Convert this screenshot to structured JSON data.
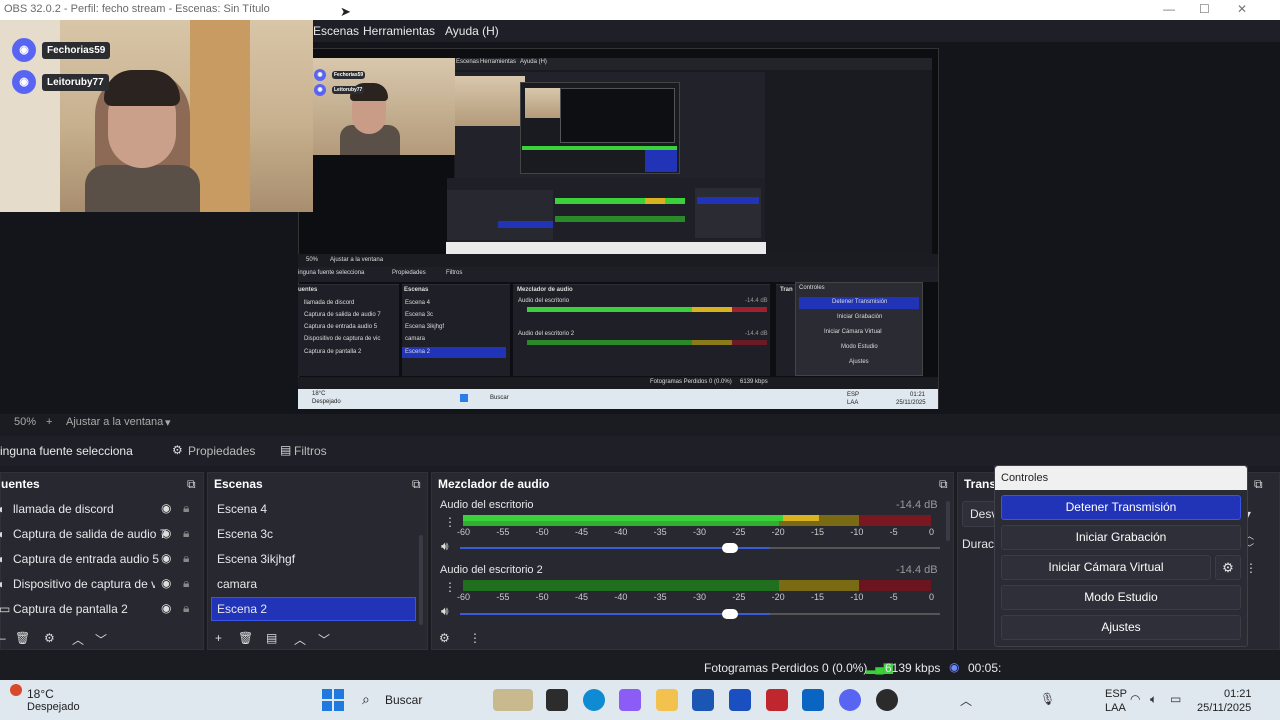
{
  "window": {
    "title": "OBS 32.0.2 - Perfil: fecho stream - Escenas: Sin Título",
    "minimize": "—",
    "maximize": "☐",
    "close": "✕"
  },
  "menu": {
    "items": [
      "Escenas",
      "Herramientas",
      "Ayuda (H)"
    ]
  },
  "webcam": {
    "discord_users": [
      "Fechorias59",
      "Leitoruby77"
    ]
  },
  "zoom": {
    "level": "50%",
    "add": "+",
    "fit_label": "Ajustar a la ventana",
    "dropdown": "▾"
  },
  "source_toolbar": {
    "no_source": "inguna fuente selecciona",
    "properties": "Propiedades",
    "filters": "Filtros"
  },
  "sources_panel": {
    "title": "uentes",
    "items": [
      "llamada de discord",
      "Captura de salida de audio 7",
      "Captura de entrada audio 5",
      "Dispositivo de captura de vic",
      "Captura de pantalla 2"
    ]
  },
  "scenes_panel": {
    "title": "Escenas",
    "items": [
      "Escena 4",
      "Escena 3c",
      "Escena 3ikjhgf",
      "camara",
      "Escena 2"
    ],
    "selected": "Escena 2"
  },
  "audio_mixer": {
    "title": "Mezclador de audio",
    "channels": [
      {
        "name": "Audio del escritorio",
        "db": "-14.4 dB",
        "level": 0.82,
        "volume": 0.72
      },
      {
        "name": "Audio del escritorio 2",
        "db": "-14.4 dB",
        "level": 0.0,
        "volume": 0.72
      }
    ],
    "scale": [
      "-60",
      "-55",
      "-50",
      "-45",
      "-40",
      "-35",
      "-30",
      "-25",
      "-20",
      "-15",
      "-10",
      "-5",
      "0"
    ]
  },
  "transitions_panel": {
    "title": "Trans",
    "type_label": "Desv",
    "duration_label": "Duraci"
  },
  "controls_panel": {
    "title": "Controles",
    "stop_stream": "Detener Transmisión",
    "start_recording": "Iniciar Grabación",
    "start_virtual_camera": "Iniciar Cámara Virtual",
    "studio_mode": "Modo Estudio",
    "settings": "Ajustes"
  },
  "status": {
    "dropped_frames": "Fotogramas Perdidos 0 (0.0%)",
    "bitrate": "6139 kbps",
    "stream_time": "00:05:"
  },
  "taskbar": {
    "weather_temp": "18°C",
    "weather_desc": "Despejado",
    "search": "Buscar",
    "lang1": "ESP",
    "lang2": "LAA",
    "time": "01:21",
    "date": "25/11/2025"
  },
  "nested_preview": {
    "menu": [
      "Escenas",
      "Herramientas",
      "Ayuda (H)"
    ],
    "sources": [
      "llamada de discord",
      "Captura de salida de audio 7",
      "Captura de entrada audio 5",
      "Dispositivo de captura de vic",
      "Captura de pantalla 2"
    ],
    "scenes": [
      "Escena 4",
      "Escena 3c",
      "Escena 3ikjhgf",
      "camara",
      "Escena 2"
    ],
    "controls": [
      "Detener Transmisión",
      "Iniciar Grabación",
      "Iniciar Cámara Virtual",
      "Modo Estudio",
      "Ajustes"
    ],
    "no_source": "inguna fuente selecciona",
    "properties": "Propiedades",
    "filters": "Filtros",
    "sources_title": "uentes",
    "scenes_title": "Escenas",
    "mixer_title": "Mezclador de audio",
    "channel1": "Audio del escritorio",
    "channel2": "Audio del escritorio 2",
    "db": "-14.4 dB",
    "controls_title": "Controles",
    "trans_title": "Tran",
    "zoom_level": "50%",
    "zoom_fit": "Ajustar a la ventana",
    "status": "Fotogramas Perdidos 0 (0.0%)",
    "bitrate": "6139 kbps",
    "search": "Buscar",
    "temp": "18°C",
    "weather": "Despejado",
    "lang1": "ESP",
    "lang2": "LAA",
    "time": "01:21",
    "date": "25/11/2025"
  },
  "colors": {
    "accent": "#2134b8",
    "meter_green": "#3ad13a",
    "meter_yellow": "#d9b21f",
    "meter_red": "#a0202e",
    "panel_bg": "#272830",
    "taskbar": "#dfe7ef"
  }
}
